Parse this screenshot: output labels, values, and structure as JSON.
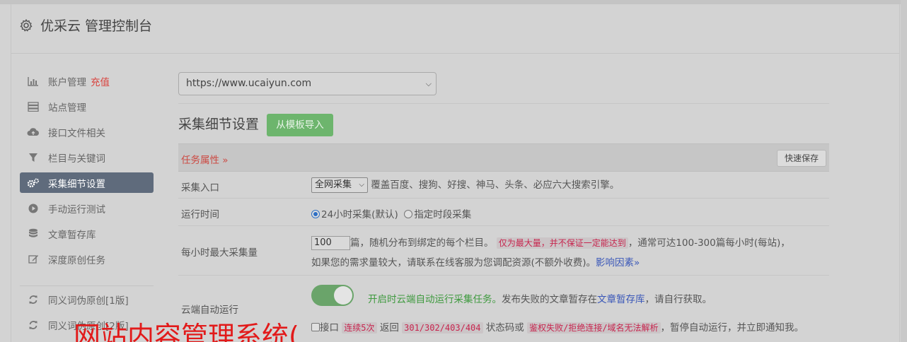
{
  "header": {
    "title": "优采云 管理控制台"
  },
  "sidebar": {
    "items": [
      {
        "label": "账户管理",
        "badge": "充值"
      },
      {
        "label": "站点管理"
      },
      {
        "label": "接口文件相关"
      },
      {
        "label": "栏目与关键词"
      },
      {
        "label": "采集细节设置"
      },
      {
        "label": "手动运行测试"
      },
      {
        "label": "文章暂存库"
      },
      {
        "label": "深度原创任务"
      },
      {
        "label": "同义词伪原创[1版]"
      },
      {
        "label": "同义词伪原创[2版]"
      }
    ]
  },
  "main": {
    "site_select": "https://www.ucaiyun.com",
    "section_title": "采集细节设置",
    "import_button": "从模板导入",
    "task_props": "任务属性 »",
    "quick_save": "快速保存",
    "rows": {
      "entry": {
        "label": "采集入口",
        "select": "全网采集",
        "desc": "覆盖百度、搜狗、好搜、神马、头条、必应六大搜索引擎。"
      },
      "runtime": {
        "label": "运行时间",
        "opt1": "24小时采集(默认)",
        "opt2": "指定时段采集"
      },
      "max": {
        "label": "每小时最大采集量",
        "value": "100",
        "text1": "篇，随机分布到绑定的每个栏目。",
        "warn": "仅为最大量，并不保证一定能达到",
        "text2": "，通常可达100-300篇每小时(每站)，",
        "text3": "如果您的需求量较大，请联系在线客服为您调配资源(不额外收费)。",
        "link": "影响因素»"
      },
      "cloud": {
        "label": "云端自动运行",
        "toggle_text": "开启时云端自动运行采集任务。",
        "text1": "发布失败的文章暂存在",
        "link": "文章暂存库",
        "text2": "，请自行获取。",
        "chk_label": "接口",
        "code1": "连续5次",
        "text3": "返回",
        "code2": "301/302/403/404",
        "text4": "状态码或",
        "code3": "鉴权失败/拒绝连接/域名无法解析",
        "text5": "，暂停自动运行，并立即通知我。"
      }
    }
  },
  "overlay": {
    "text": "网站内容管理系统("
  },
  "colors": {
    "accent_green": "#6db56d",
    "active_nav": "#5f6b7c",
    "warn_red": "#c7254e",
    "badge_red": "#d9423d",
    "link_blue": "#3a57b8"
  }
}
